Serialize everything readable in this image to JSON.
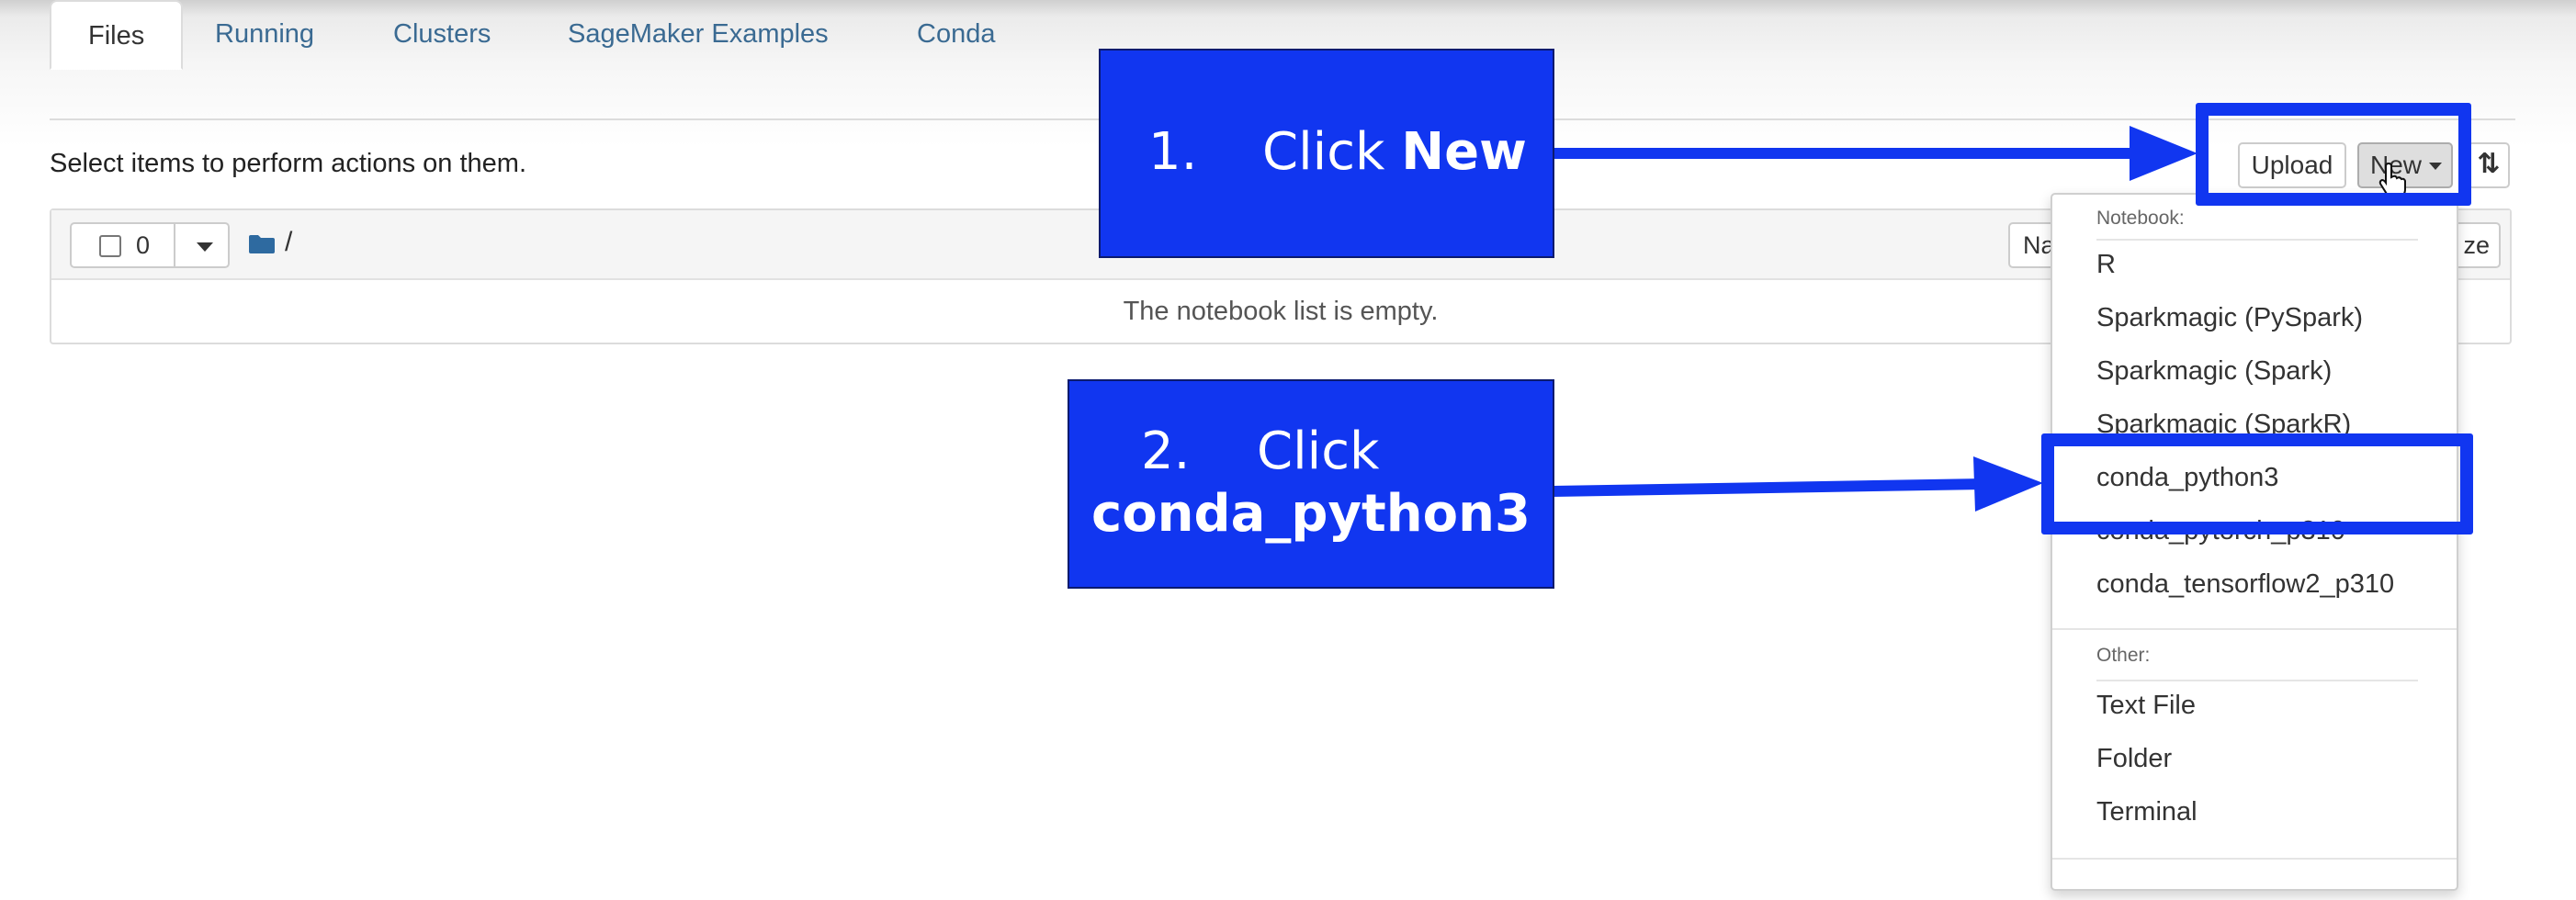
{
  "tabs": [
    "Files",
    "Running",
    "Clusters",
    "SageMaker Examples",
    "Conda"
  ],
  "select_text": "Select items to perform actions on them.",
  "list": {
    "selected_count": "0",
    "path": "/",
    "name_sort_label": "Na",
    "size_sort_label": "ze",
    "empty_message": "The notebook list is empty."
  },
  "toolbar": {
    "upload_label": "Upload",
    "new_label": "New",
    "refresh_icon": "refresh-icon"
  },
  "new_menu": {
    "notebook_header": "Notebook:",
    "notebook_items": [
      "R",
      "Sparkmagic (PySpark)",
      "Sparkmagic (Spark)",
      "Sparkmagic (SparkR)",
      "conda_python3",
      "conda_pytorch_p310",
      "conda_tensorflow2_p310"
    ],
    "other_header": "Other:",
    "other_items": [
      "Text File",
      "Folder",
      "Terminal"
    ]
  },
  "annotations": {
    "step1_number": "1.",
    "step1_text": "Click",
    "step1_bold": "New",
    "step2_number": "2.",
    "step2_text": "Click",
    "step2_bold": "conda_python3",
    "color": "#1136f0"
  }
}
